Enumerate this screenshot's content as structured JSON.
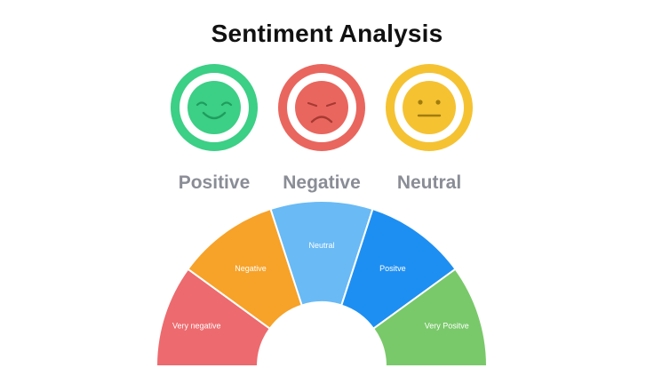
{
  "title": "Sentiment Analysis",
  "faces": [
    {
      "label": "Positive",
      "expression": "smile",
      "color": "#3ccf86",
      "icon": "smiling-face-icon"
    },
    {
      "label": "Negative",
      "expression": "frown",
      "color": "#e9665e",
      "icon": "frowning-face-icon"
    },
    {
      "label": "Neutral",
      "expression": "flat",
      "color": "#f5c232",
      "icon": "neutral-face-icon"
    }
  ],
  "gauge": {
    "segments": [
      {
        "label": "Very negative",
        "color": "#ed6a6e"
      },
      {
        "label": "Negative",
        "color": "#f7a228"
      },
      {
        "label": "Neutral",
        "color": "#69baf5"
      },
      {
        "label": "Positve",
        "color": "#1e8ff2"
      },
      {
        "label": "Very Positve",
        "color": "#79c96a"
      }
    ]
  }
}
